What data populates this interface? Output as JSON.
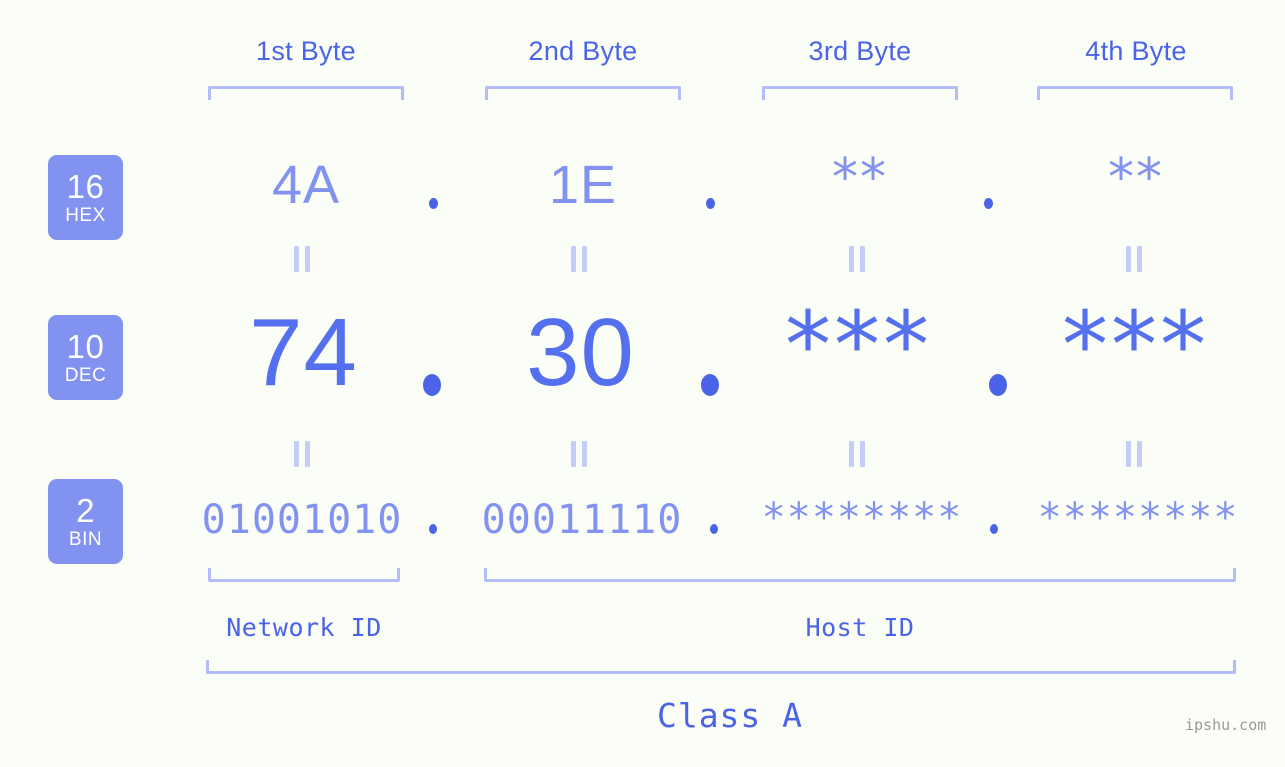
{
  "background_color": "#fbfdf7",
  "accent_dark": "#4a63e7",
  "accent_mid": "#5570ee",
  "accent_light": "#8292f0",
  "accent_pale": "#b3bdf7",
  "columns": [
    {
      "title": "1st Byte"
    },
    {
      "title": "2nd Byte"
    },
    {
      "title": "3rd Byte"
    },
    {
      "title": "4th Byte"
    }
  ],
  "bases": [
    {
      "number": "16",
      "name": "HEX"
    },
    {
      "number": "10",
      "name": "DEC"
    },
    {
      "number": "2",
      "name": "BIN"
    }
  ],
  "rows": {
    "hex": {
      "values": [
        "4A",
        "1E",
        "**",
        "**"
      ]
    },
    "dec": {
      "values": [
        "74",
        "30",
        "***",
        "***"
      ]
    },
    "bin": {
      "values": [
        "01001010",
        "00011110",
        "********",
        "********"
      ]
    }
  },
  "separator": ".",
  "equals_mark": "=",
  "segments": [
    {
      "label": "Network ID"
    },
    {
      "label": "Host ID"
    }
  ],
  "class_label": "Class A",
  "watermark": "ipshu.com"
}
